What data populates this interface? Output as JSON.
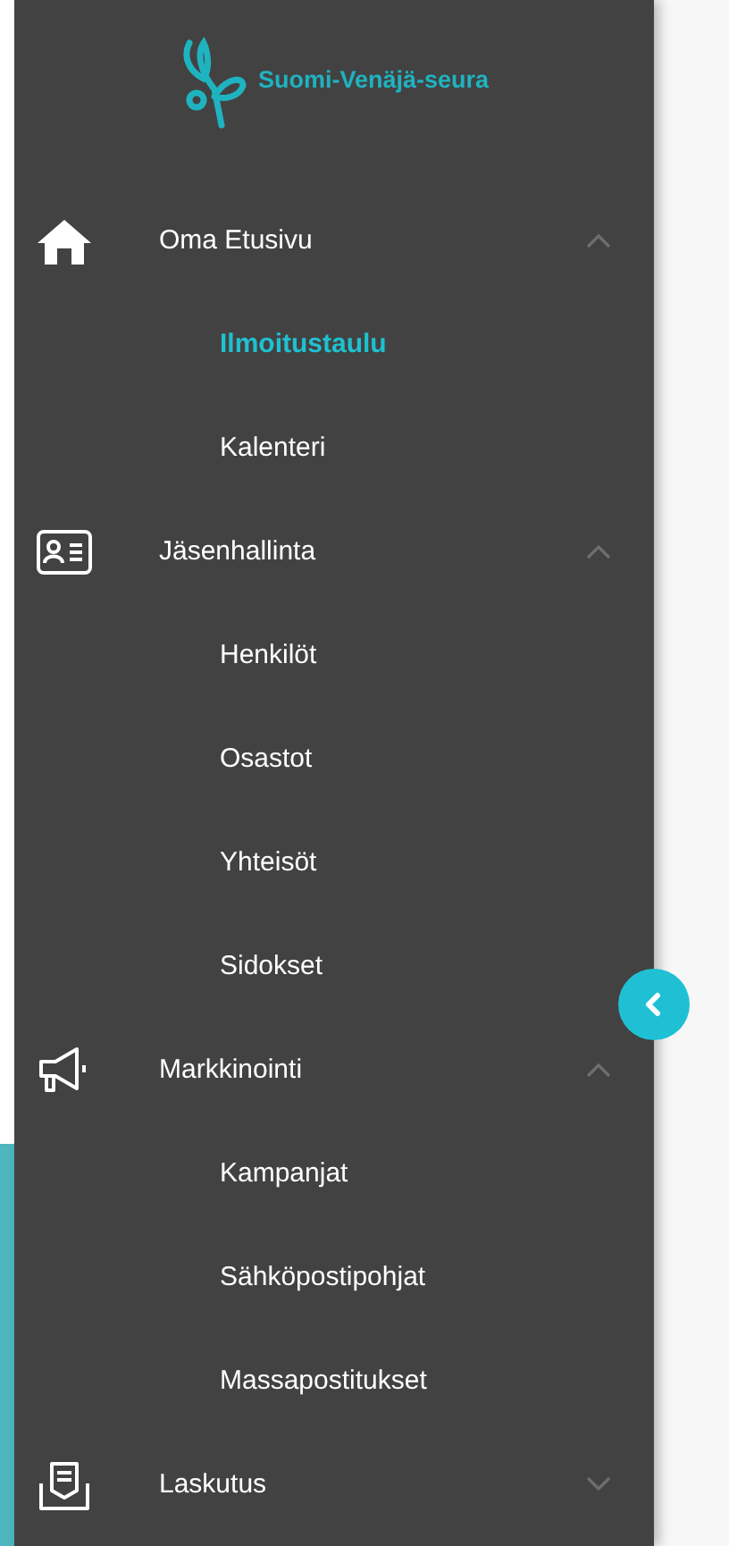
{
  "logo": {
    "text": "Suomi-Venäjä-seura"
  },
  "menu": [
    {
      "label": "Oma Etusivu",
      "expanded": true,
      "children": [
        {
          "label": "Ilmoitustaulu",
          "selected": true
        },
        {
          "label": "Kalenteri",
          "selected": false
        }
      ]
    },
    {
      "label": "Jäsenhallinta",
      "expanded": true,
      "children": [
        {
          "label": "Henkilöt",
          "selected": false
        },
        {
          "label": "Osastot",
          "selected": false
        },
        {
          "label": "Yhteisöt",
          "selected": false
        },
        {
          "label": "Sidokset",
          "selected": false
        }
      ]
    },
    {
      "label": "Markkinointi",
      "expanded": true,
      "children": [
        {
          "label": "Kampanjat",
          "selected": false
        },
        {
          "label": "Sähköpostipohjat",
          "selected": false
        },
        {
          "label": "Massapostitukset",
          "selected": false
        }
      ]
    },
    {
      "label": "Laskutus",
      "expanded": false
    }
  ]
}
